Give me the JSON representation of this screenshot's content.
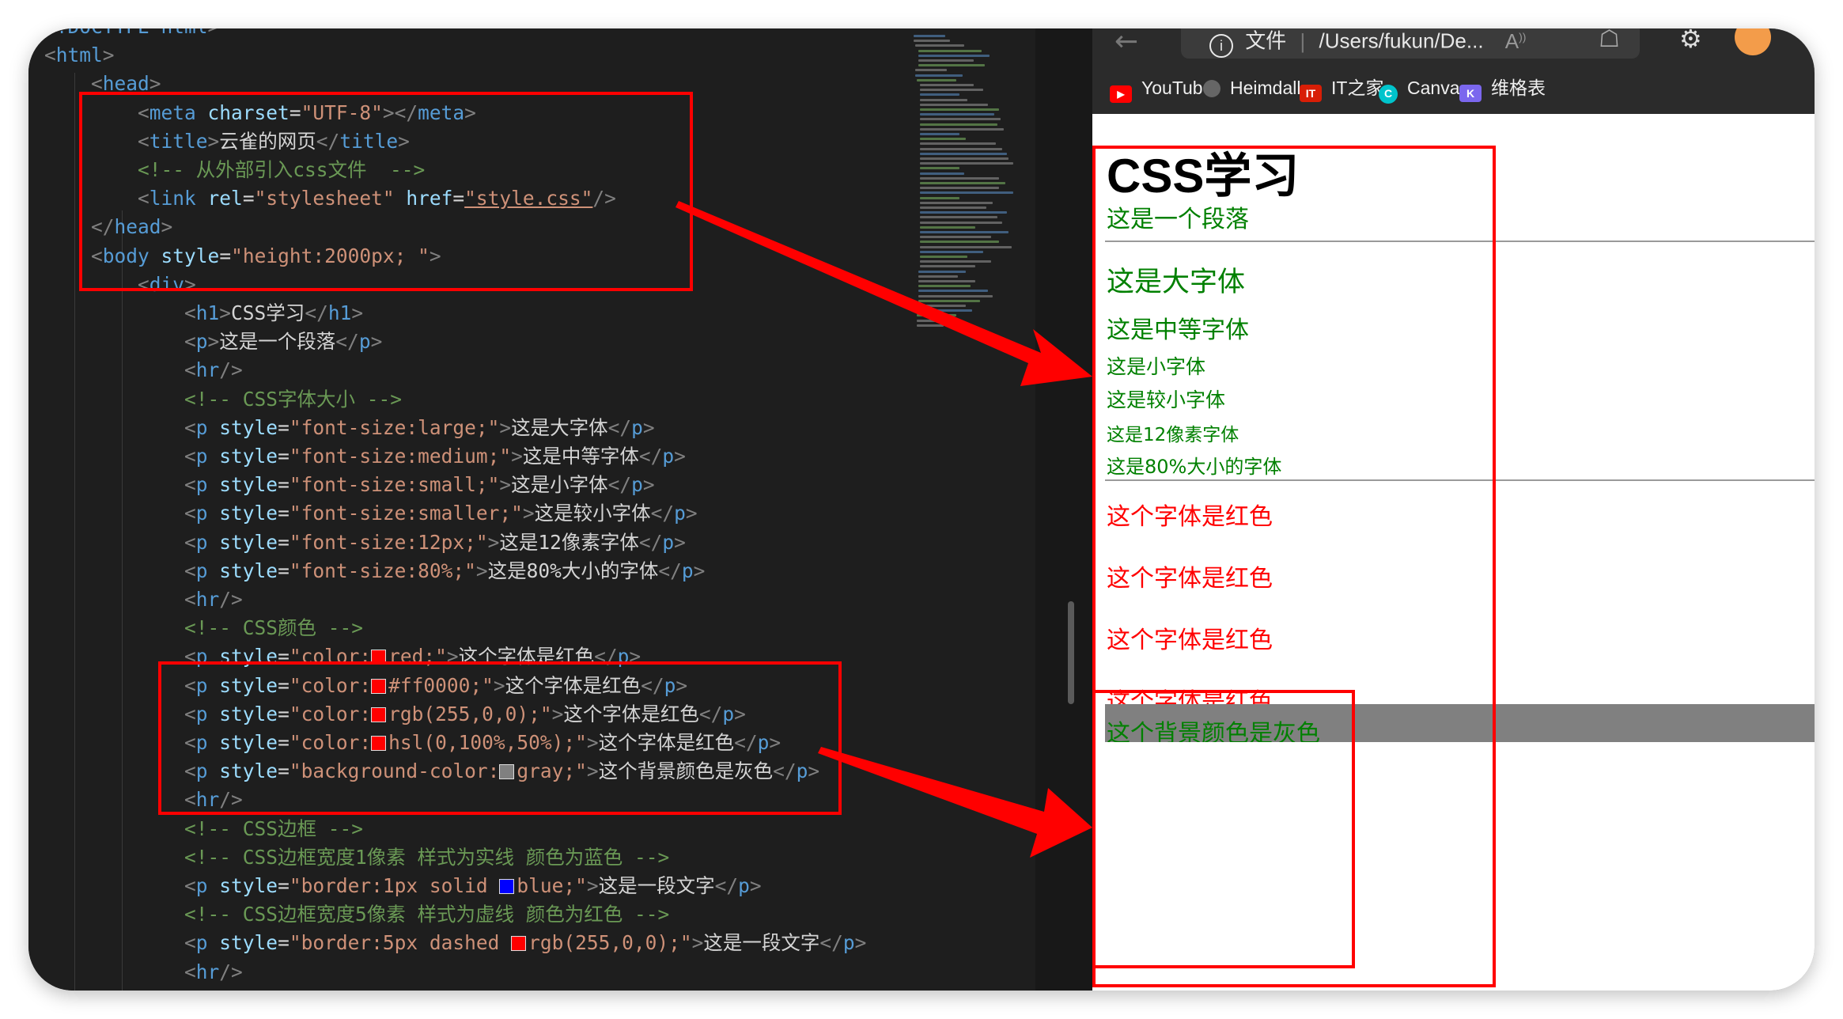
{
  "editor": {
    "lines": [
      [
        "<!DOCTYPE ",
        "html",
        ">"
      ],
      [
        "<",
        "html",
        ">"
      ],
      [
        "<",
        "head",
        ">"
      ],
      [
        "<",
        "meta",
        " ",
        "charset",
        "=",
        "\"UTF-8\"",
        "></",
        "meta",
        ">"
      ],
      [
        "<",
        "title",
        ">",
        "云雀的网页",
        "</",
        "title",
        ">"
      ],
      [
        "<!-- 从外部引入css文件  -->"
      ],
      [
        "<",
        "link",
        " ",
        "rel",
        "=",
        "\"stylesheet\"",
        " ",
        "href",
        "=",
        "\"style.css\"",
        "/>"
      ],
      [
        "</",
        "head",
        ">"
      ],
      [
        "<",
        "body",
        " ",
        "style",
        "=",
        "\"height:2000px; \"",
        ">"
      ],
      [
        "<",
        "div",
        ">"
      ],
      [
        "<",
        "h1",
        ">",
        "CSS学习",
        "</",
        "h1",
        ">"
      ],
      [
        "<",
        "p",
        ">",
        "这是一个段落",
        "</",
        "p",
        ">"
      ],
      [
        "<",
        "hr",
        "/>"
      ],
      [
        "<!-- CSS字体大小 -->"
      ],
      [
        "<",
        "p",
        " ",
        "style",
        "=",
        "\"font-size:large;\"",
        ">",
        "这是大字体",
        "</",
        "p",
        ">"
      ],
      [
        "<",
        "p",
        " ",
        "style",
        "=",
        "\"font-size:medium;\"",
        ">",
        "这是中等字体",
        "</",
        "p",
        ">"
      ],
      [
        "<",
        "p",
        " ",
        "style",
        "=",
        "\"font-size:small;\"",
        ">",
        "这是小字体",
        "</",
        "p",
        ">"
      ],
      [
        "<",
        "p",
        " ",
        "style",
        "=",
        "\"font-size:smaller;\"",
        ">",
        "这是较小字体",
        "</",
        "p",
        ">"
      ],
      [
        "<",
        "p",
        " ",
        "style",
        "=",
        "\"font-size:12px;\"",
        ">",
        "这是12像素字体",
        "</",
        "p",
        ">"
      ],
      [
        "<",
        "p",
        " ",
        "style",
        "=",
        "\"font-size:80%;\"",
        ">",
        "这是80%大小的字体",
        "</",
        "p",
        ">"
      ],
      [
        "<",
        "hr",
        "/>"
      ],
      [
        "<!-- CSS颜色 -->"
      ],
      [
        "<",
        "p",
        " ",
        "style",
        "=",
        "\"color:",
        "red;\"",
        ">",
        "这个字体是红色",
        "</",
        "p",
        ">"
      ],
      [
        "<",
        "p",
        " ",
        "style",
        "=",
        "\"color:",
        "#ff0000;\"",
        ">",
        "这个字体是红色",
        "</",
        "p",
        ">"
      ],
      [
        "<",
        "p",
        " ",
        "style",
        "=",
        "\"color:",
        "rgb(255,0,0);\"",
        ">",
        "这个字体是红色",
        "</",
        "p",
        ">"
      ],
      [
        "<",
        "p",
        " ",
        "style",
        "=",
        "\"color:",
        "hsl(0,100%,50%);\"",
        ">",
        "这个字体是红色",
        "</",
        "p",
        ">"
      ],
      [
        "<",
        "p",
        " ",
        "style",
        "=",
        "\"background-color:",
        "gray;\"",
        ">",
        "这个背景颜色是灰色",
        "</",
        "p",
        ">"
      ],
      [
        "<",
        "hr",
        "/>"
      ],
      [
        "<!-- CSS边框 -->"
      ],
      [
        "<!-- CSS边框宽度1像素 样式为实线 颜色为蓝色 -->"
      ],
      [
        "<",
        "p",
        " ",
        "style",
        "=",
        "\"border:1px solid ",
        "blue;\"",
        ">",
        "这是一段文字",
        "</",
        "p",
        ">"
      ],
      [
        "<!-- CSS边框宽度5像素 样式为虚线 颜色为红色 -->"
      ],
      [
        "<",
        "p",
        " ",
        "style",
        "=",
        "\"border:5px dashed ",
        "rgb(255,0,0);\"",
        ">",
        "这是一段文字",
        "</",
        "p",
        ">"
      ],
      [
        "<",
        "hr",
        "/>"
      ]
    ],
    "swatches": {
      "22": "#ff0000",
      "23": "#ff0000",
      "24": "#ff0000",
      "25": "#ff0000",
      "26": "#808080",
      "30": "#0000ff",
      "32": "#ff0000"
    }
  },
  "browser": {
    "address_info": "文件",
    "address_path": "/Users/fukun/De...",
    "reader_icon": "A̅",
    "bookmarks": [
      {
        "label": "YouTube",
        "icon": "youtube-icon",
        "color": "#ff0000"
      },
      {
        "label": "Heimdall",
        "icon": "heimdall-icon",
        "color": "#666666"
      },
      {
        "label": "IT之家",
        "icon": "ithome-icon",
        "color": "#d81e06"
      },
      {
        "label": "Canva",
        "icon": "canva-icon",
        "color": "#00c4cc"
      },
      {
        "label": "维格表",
        "icon": "vika-icon",
        "color": "#7b67ee"
      }
    ],
    "page": {
      "h1": "CSS学习",
      "p1": "这是一个段落",
      "large": "这是大字体",
      "medium": "这是中等字体",
      "small": "这是小字体",
      "smaller": "这是较小字体",
      "px12": "这是12像素字体",
      "pct80": "这是80%大小的字体",
      "red": [
        "这个字体是红色",
        "这个字体是红色",
        "这个字体是红色",
        "这个字体是红色"
      ],
      "gray_bg": "这个背景颜色是灰色"
    }
  },
  "annotation_color": "#ff0000"
}
